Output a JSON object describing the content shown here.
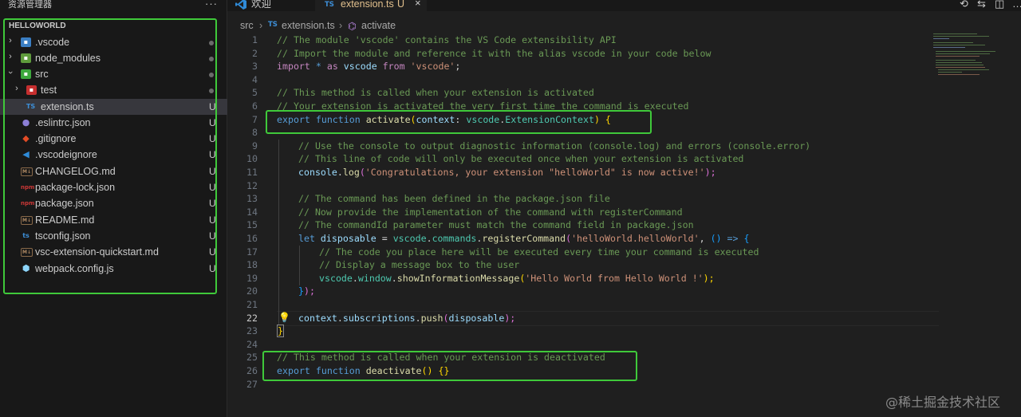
{
  "sidebar": {
    "title": "资源管理器",
    "more_label": "···",
    "root": "HELLOWORLD",
    "items": [
      {
        "label": ".vscode",
        "status": "",
        "dot": true
      },
      {
        "label": "node_modules",
        "status": "",
        "dot": true
      },
      {
        "label": "src",
        "status": "",
        "dot": true
      },
      {
        "label": "test",
        "status": "",
        "dot": true
      },
      {
        "label": "extension.ts",
        "status": "U",
        "dot": false
      },
      {
        "label": ".eslintrc.json",
        "status": "U",
        "dot": false
      },
      {
        "label": ".gitignore",
        "status": "U",
        "dot": false
      },
      {
        "label": ".vscodeignore",
        "status": "U",
        "dot": false
      },
      {
        "label": "CHANGELOG.md",
        "status": "U",
        "dot": false
      },
      {
        "label": "package-lock.json",
        "status": "U",
        "dot": false
      },
      {
        "label": "package.json",
        "status": "U",
        "dot": false
      },
      {
        "label": "README.md",
        "status": "U",
        "dot": false
      },
      {
        "label": "tsconfig.json",
        "status": "U",
        "dot": false
      },
      {
        "label": "vsc-extension-quickstart.md",
        "status": "U",
        "dot": false
      },
      {
        "label": "webpack.config.js",
        "status": "U",
        "dot": false
      }
    ]
  },
  "tabs": [
    {
      "label": "欢迎"
    },
    {
      "label": "extension.ts",
      "badge": "TS",
      "status": "U",
      "close": "×"
    }
  ],
  "breadcrumb": {
    "folder": "src",
    "file_badge": "TS",
    "file": "extension.ts",
    "symbol": "activate"
  },
  "editor": {
    "active_line": 22,
    "lines": [
      {
        "n": "1"
      },
      {
        "n": "2"
      },
      {
        "n": "3"
      },
      {
        "n": "4"
      },
      {
        "n": "5"
      },
      {
        "n": "6"
      },
      {
        "n": "7"
      },
      {
        "n": "8"
      },
      {
        "n": "9"
      },
      {
        "n": "10"
      },
      {
        "n": "11"
      },
      {
        "n": "12"
      },
      {
        "n": "13"
      },
      {
        "n": "14"
      },
      {
        "n": "15"
      },
      {
        "n": "16"
      },
      {
        "n": "17"
      },
      {
        "n": "18"
      },
      {
        "n": "19"
      },
      {
        "n": "20"
      },
      {
        "n": "21"
      },
      {
        "n": "22"
      },
      {
        "n": "23"
      },
      {
        "n": "24"
      },
      {
        "n": "25"
      },
      {
        "n": "26"
      },
      {
        "n": "27"
      }
    ],
    "code": {
      "l1": "// The module 'vscode' contains the VS Code extensibility API",
      "l2": "// Import the module and reference it with the alias vscode in your code below",
      "l3_import": "import",
      "l3_star": " * ",
      "l3_as": "as",
      "l3_name": " vscode ",
      "l3_from": "from",
      "l3_str": " 'vscode'",
      "l3_end": ";",
      "l5": "// This method is called when your extension is activated",
      "l6": "// Your extension is activated the very first time the command is executed",
      "l7_export": "export",
      "l7_function": " function ",
      "l7_name": "activate",
      "l7_paren": "(",
      "l7_param": "context",
      "l7_colon": ": ",
      "l7_ns": "vscode",
      "l7_dot": ".",
      "l7_type": "ExtensionContext",
      "l7_close": ") ",
      "l7_brace": "{",
      "l9": "// Use the console to output diagnostic information (console.log) and errors (console.error)",
      "l10": "// This line of code will only be executed once when your extension is activated",
      "l11_obj": "console",
      "l11_dot": ".",
      "l11_fn": "log",
      "l11_open": "(",
      "l11_str": "'Congratulations, your extension \"helloWorld\" is now active!'",
      "l11_close": ");",
      "l13": "// The command has been defined in the package.json file",
      "l14": "// Now provide the implementation of the command with registerCommand",
      "l15": "// The commandId parameter must match the command field in package.json",
      "l16_let": "let",
      "l16_var": " disposable",
      "l16_eq": " = ",
      "l16_ns": "vscode",
      "l16_dot1": ".",
      "l16_cmds": "commands",
      "l16_dot2": ".",
      "l16_fn": "registerCommand",
      "l16_open": "(",
      "l16_str": "'helloWorld.helloWorld'",
      "l16_comma": ", ",
      "l16_arrow_paren": "()",
      "l16_arrow": " => ",
      "l16_brace": "{",
      "l17": "// The code you place here will be executed every time your command is executed",
      "l18": "// Display a message box to the user",
      "l19_ns": "vscode",
      "l19_dot1": ".",
      "l19_win": "window",
      "l19_dot2": ".",
      "l19_fn": "showInformationMessage",
      "l19_open": "(",
      "l19_str": "'Hello World from Hello World !'",
      "l19_close": ");",
      "l20_brace": "}",
      "l20_end": ");",
      "l22_ctx": "context",
      "l22_dot1": ".",
      "l22_subs": "subscriptions",
      "l22_dot2": ".",
      "l22_fn": "push",
      "l22_open": "(",
      "l22_var": "disposable",
      "l22_close": ");",
      "l23": "}",
      "l25": "// This method is called when your extension is deactivated",
      "l26_export": "export",
      "l26_function": " function ",
      "l26_name": "deactivate",
      "l26_paren": "() ",
      "l26_braces": "{}"
    }
  },
  "watermark": "@稀土掘金技术社区",
  "colors": {
    "highlight_box": "#3fc93a",
    "comment": "#6a9955",
    "keyword": "#569cd6",
    "string": "#ce9178"
  }
}
